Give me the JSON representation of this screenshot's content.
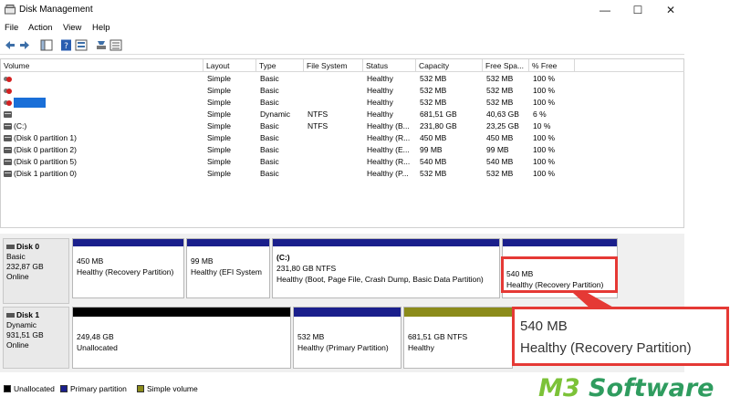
{
  "window": {
    "title": "Disk Management",
    "controls": {
      "minimize": "—",
      "maximize": "☐",
      "close": "✕"
    }
  },
  "menu": [
    "File",
    "Action",
    "View",
    "Help"
  ],
  "toolbar": {
    "icons": [
      "back-arrow-icon",
      "forward-arrow-icon",
      "console-tree-icon",
      "help-icon",
      "properties-icon",
      "rescan-icon",
      "disk-list-icon"
    ]
  },
  "table": {
    "columns": [
      "Volume",
      "Layout",
      "Type",
      "File System",
      "Status",
      "Capacity",
      "Free Spa...",
      "% Free"
    ],
    "rows": [
      {
        "icon": "error",
        "volume": "",
        "layout": "Simple",
        "type": "Basic",
        "fs": "",
        "status": "Healthy",
        "capacity": "532 MB",
        "free": "532 MB",
        "pct": "100 %"
      },
      {
        "icon": "error",
        "volume": "",
        "layout": "Simple",
        "type": "Basic",
        "fs": "",
        "status": "Healthy",
        "capacity": "532 MB",
        "free": "532 MB",
        "pct": "100 %"
      },
      {
        "icon": "error",
        "volume": "",
        "redacted": true,
        "layout": "Simple",
        "type": "Basic",
        "fs": "",
        "status": "Healthy",
        "capacity": "532 MB",
        "free": "532 MB",
        "pct": "100 %"
      },
      {
        "icon": "drive",
        "volume": "",
        "layout": "Simple",
        "type": "Dynamic",
        "fs": "NTFS",
        "status": "Healthy",
        "capacity": "681,51 GB",
        "free": "40,63 GB",
        "pct": "6 %"
      },
      {
        "icon": "drive",
        "volume": "(C:)",
        "layout": "Simple",
        "type": "Basic",
        "fs": "NTFS",
        "status": "Healthy (B...",
        "capacity": "231,80 GB",
        "free": "23,25 GB",
        "pct": "10 %"
      },
      {
        "icon": "drive",
        "volume": "(Disk 0 partition 1)",
        "layout": "Simple",
        "type": "Basic",
        "fs": "",
        "status": "Healthy (R...",
        "capacity": "450 MB",
        "free": "450 MB",
        "pct": "100 %"
      },
      {
        "icon": "drive",
        "volume": "(Disk 0 partition 2)",
        "layout": "Simple",
        "type": "Basic",
        "fs": "",
        "status": "Healthy (E...",
        "capacity": "99 MB",
        "free": "99 MB",
        "pct": "100 %"
      },
      {
        "icon": "drive",
        "volume": "(Disk 0 partition 5)",
        "layout": "Simple",
        "type": "Basic",
        "fs": "",
        "status": "Healthy (R...",
        "capacity": "540 MB",
        "free": "540 MB",
        "pct": "100 %"
      },
      {
        "icon": "drive",
        "volume": "(Disk 1 partition 0)",
        "layout": "Simple",
        "type": "Basic",
        "fs": "",
        "status": "Healthy (P...",
        "capacity": "532 MB",
        "free": "532 MB",
        "pct": "100 %"
      }
    ]
  },
  "disks": [
    {
      "name": "Disk 0",
      "type": "Basic",
      "size": "232,87 GB",
      "status": "Online",
      "partitions": [
        {
          "line1": "450 MB",
          "line2": "Healthy (Recovery Partition)",
          "bar": "primary"
        },
        {
          "line1": "99 MB",
          "line2": "Healthy (EFI System",
          "bar": "primary"
        },
        {
          "line0": "(C:)",
          "line1": "231,80 GB NTFS",
          "line2": "Healthy (Boot, Page File, Crash Dump, Basic Data Partition)",
          "bar": "primary"
        },
        {
          "line1": "540 MB",
          "line2": "Healthy (Recovery Partition)",
          "bar": "primary"
        }
      ]
    },
    {
      "name": "Disk 1",
      "type": "Dynamic",
      "size": "931,51 GB",
      "status": "Online",
      "partitions": [
        {
          "line1": "249,48 GB",
          "line2": "Unallocated",
          "bar": "unallocated"
        },
        {
          "line1": "532 MB",
          "line2": "Healthy (Primary Partition)",
          "bar": "primary"
        },
        {
          "line1": "681,51 GB NTFS",
          "line2": "Healthy",
          "bar": "simple"
        }
      ]
    }
  ],
  "legend": [
    {
      "label": "Unallocated",
      "color": "#000000"
    },
    {
      "label": "Primary partition",
      "color": "#1a1f8c"
    },
    {
      "label": "Simple volume",
      "color": "#8b8b1a"
    }
  ],
  "callout": {
    "line1": "540 MB",
    "line2": "Healthy (Recovery Partition)",
    "color": "#e53935"
  },
  "watermark": {
    "part1": "M3",
    "part2": " Software"
  },
  "colors": {
    "primary": "#1a1f8c",
    "unallocated": "#000000",
    "simple": "#8b8b1a",
    "highlight": "#e53935"
  }
}
